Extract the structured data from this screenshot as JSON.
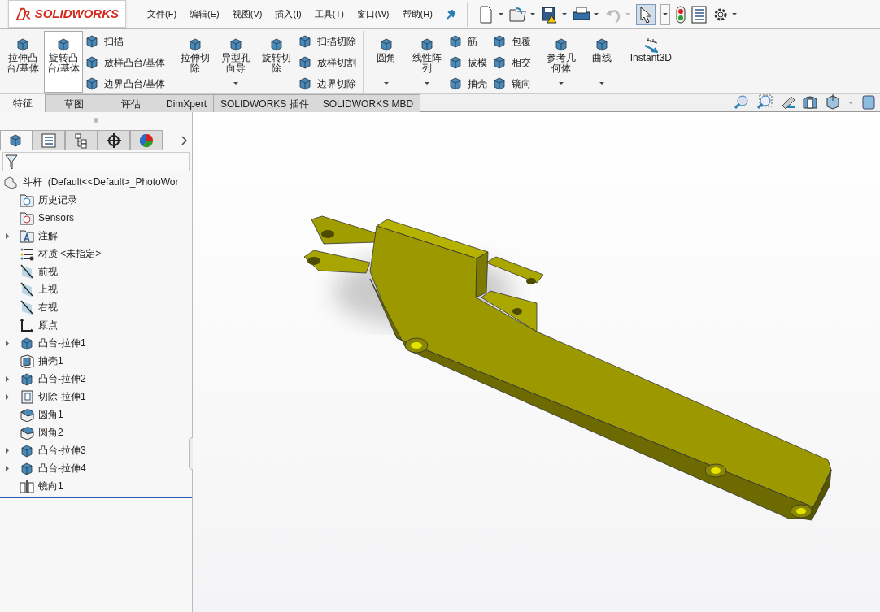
{
  "app": {
    "logo": "SOLIDWORKS"
  },
  "menu": [
    "文件(F)",
    "编辑(E)",
    "视图(V)",
    "插入(I)",
    "工具(T)",
    "窗口(W)",
    "帮助(H)"
  ],
  "quick_toolbar": {
    "pointer_selected": true
  },
  "ribbon_groups": [
    {
      "commands": [
        {
          "kind": "large",
          "label": "拉伸凸台/基体",
          "selected": false,
          "dropdown": false
        },
        {
          "kind": "large",
          "label": "旋转凸台/基体",
          "selected": true,
          "dropdown": false
        }
      ],
      "columns": [
        [
          "扫描",
          "放样凸台/基体",
          "边界凸台/基体"
        ]
      ]
    },
    {
      "commands": [
        {
          "kind": "large",
          "label": "拉伸切除",
          "selected": false,
          "dropdown": false
        },
        {
          "kind": "large",
          "label": "异型孔向导",
          "selected": false,
          "dropdown": true
        },
        {
          "kind": "large",
          "label": "旋转切除",
          "selected": false,
          "dropdown": false
        }
      ],
      "columns": [
        [
          "扫描切除",
          "放样切割",
          "边界切除"
        ]
      ]
    },
    {
      "commands": [
        {
          "kind": "large",
          "label": "圆角",
          "selected": false,
          "dropdown": true
        },
        {
          "kind": "large",
          "label": "线性阵列",
          "selected": false,
          "dropdown": true
        }
      ],
      "columns": [
        [
          "筋",
          "拔模",
          "抽壳"
        ],
        [
          "包覆",
          "相交",
          "镜向"
        ]
      ]
    },
    {
      "commands": [
        {
          "kind": "large",
          "label": "参考几何体",
          "selected": false,
          "dropdown": true
        },
        {
          "kind": "large",
          "label": "曲线",
          "selected": false,
          "dropdown": true
        }
      ]
    },
    {
      "commands": [
        {
          "kind": "wide",
          "label": "Instant3D",
          "selected": false,
          "dropdown": false
        }
      ]
    }
  ],
  "ribbon_tabs": [
    {
      "label": "特征",
      "selected": true
    },
    {
      "label": "草图",
      "selected": false
    },
    {
      "label": "评估",
      "selected": false
    },
    {
      "label": "DimXpert",
      "selected": false
    },
    {
      "label": "SOLIDWORKS 插件",
      "selected": false
    },
    {
      "label": "SOLIDWORKS MBD",
      "selected": false
    }
  ],
  "panel_tabs": [
    {
      "selected": true
    },
    {
      "selected": false
    },
    {
      "selected": false
    },
    {
      "selected": false
    },
    {
      "selected": false
    }
  ],
  "feature_tree": {
    "label": "斗杆  (Default<<Default>_PhotoWor",
    "children": [
      {
        "kind": "history",
        "label": "历史记录",
        "has_children": false
      },
      {
        "kind": "sensors",
        "label": "Sensors",
        "has_children": false
      },
      {
        "kind": "annotations",
        "label": "注解",
        "has_children": true
      },
      {
        "kind": "material",
        "label": "材质 <未指定>",
        "has_children": false
      },
      {
        "kind": "plane",
        "label": "前视",
        "has_children": false
      },
      {
        "kind": "plane",
        "label": "上视",
        "has_children": false
      },
      {
        "kind": "plane",
        "label": "右视",
        "has_children": false
      },
      {
        "kind": "origin",
        "label": "原点",
        "has_children": false
      },
      {
        "kind": "extrude",
        "label": "凸台-拉伸1",
        "has_children": true
      },
      {
        "kind": "shell",
        "label": "抽壳1",
        "has_children": false
      },
      {
        "kind": "extrude",
        "label": "凸台-拉伸2",
        "has_children": true
      },
      {
        "kind": "cut",
        "label": "切除-拉伸1",
        "has_children": true
      },
      {
        "kind": "fillet",
        "label": "圆角1",
        "has_children": false
      },
      {
        "kind": "fillet",
        "label": "圆角2",
        "has_children": false
      },
      {
        "kind": "extrude",
        "label": "凸台-拉伸3",
        "has_children": true
      },
      {
        "kind": "extrude",
        "label": "凸台-拉伸4",
        "has_children": true
      },
      {
        "kind": "mirror",
        "label": "镜向1",
        "has_children": false
      }
    ]
  }
}
